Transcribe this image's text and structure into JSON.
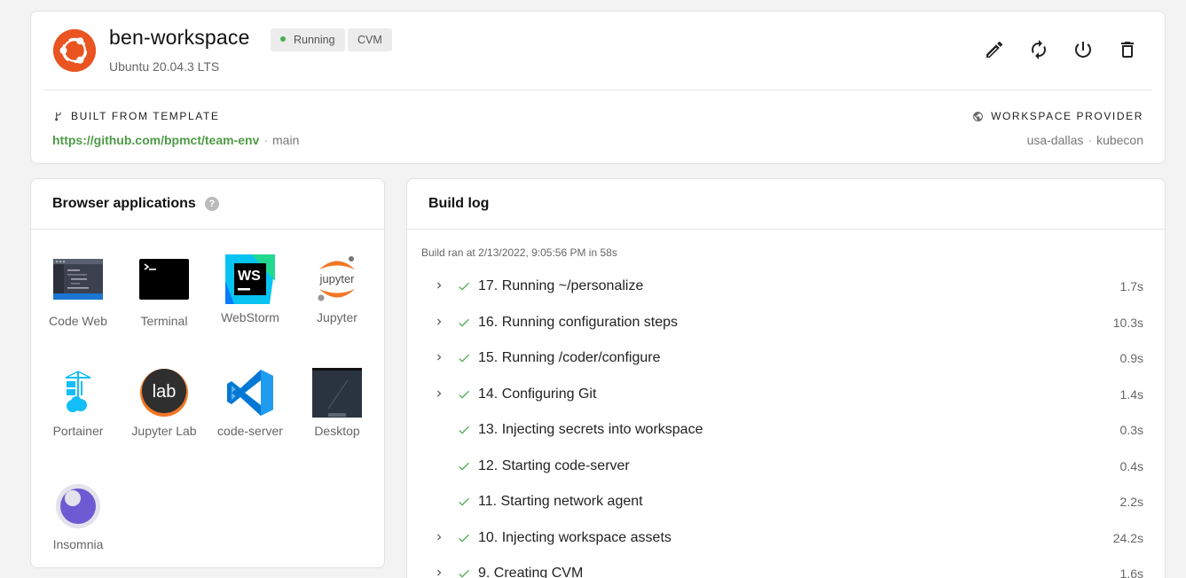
{
  "workspace": {
    "name": "ben-workspace",
    "status": "Running",
    "type": "CVM",
    "os": "Ubuntu 20.04.3 LTS",
    "logo": "ubuntu-logo",
    "status_color": "#4caf50",
    "brand_color": "#e95420"
  },
  "actions": [
    {
      "name": "edit",
      "icon": "pencil-icon"
    },
    {
      "name": "rebuild",
      "icon": "refresh-icon"
    },
    {
      "name": "power",
      "icon": "power-icon"
    },
    {
      "name": "delete",
      "icon": "trash-icon"
    }
  ],
  "template": {
    "title": "BUILT FROM TEMPLATE",
    "icon": "branch-icon",
    "repo": "https://github.com/bpmct/team-env",
    "branch": "main"
  },
  "provider": {
    "title": "WORKSPACE PROVIDER",
    "icon": "globe-icon",
    "region": "usa-dallas",
    "cluster": "kubecon"
  },
  "apps": {
    "title": "Browser applications",
    "help": "?",
    "items": [
      {
        "label": "Code Web",
        "icon": "code-web-icon"
      },
      {
        "label": "Terminal",
        "icon": "terminal-icon"
      },
      {
        "label": "WebStorm",
        "icon": "webstorm-icon"
      },
      {
        "label": "Jupyter",
        "icon": "jupyter-icon"
      },
      {
        "label": "Portainer",
        "icon": "portainer-icon"
      },
      {
        "label": "Jupyter Lab",
        "icon": "jupyterlab-icon"
      },
      {
        "label": "code-server",
        "icon": "vscode-icon"
      },
      {
        "label": "Desktop",
        "icon": "desktop-icon"
      },
      {
        "label": "Insomnia",
        "icon": "insomnia-icon"
      }
    ]
  },
  "build_log": {
    "title": "Build log",
    "summary": "Build ran at 2/13/2022, 9:05:56 PM in 58s",
    "steps": [
      {
        "label": "17. Running ~/personalize",
        "duration": "1.7s",
        "expandable": true
      },
      {
        "label": "16. Running configuration steps",
        "duration": "10.3s",
        "expandable": true
      },
      {
        "label": "15. Running /coder/configure",
        "duration": "0.9s",
        "expandable": true
      },
      {
        "label": "14. Configuring Git",
        "duration": "1.4s",
        "expandable": true
      },
      {
        "label": "13. Injecting secrets into workspace",
        "duration": "0.3s",
        "expandable": false
      },
      {
        "label": "12. Starting code-server",
        "duration": "0.4s",
        "expandable": false
      },
      {
        "label": "11. Starting network agent",
        "duration": "2.2s",
        "expandable": false
      },
      {
        "label": "10. Injecting workspace assets",
        "duration": "24.2s",
        "expandable": true
      },
      {
        "label": "9. Creating CVM",
        "duration": "1.6s",
        "expandable": true
      }
    ],
    "success_color": "#4caf50"
  }
}
